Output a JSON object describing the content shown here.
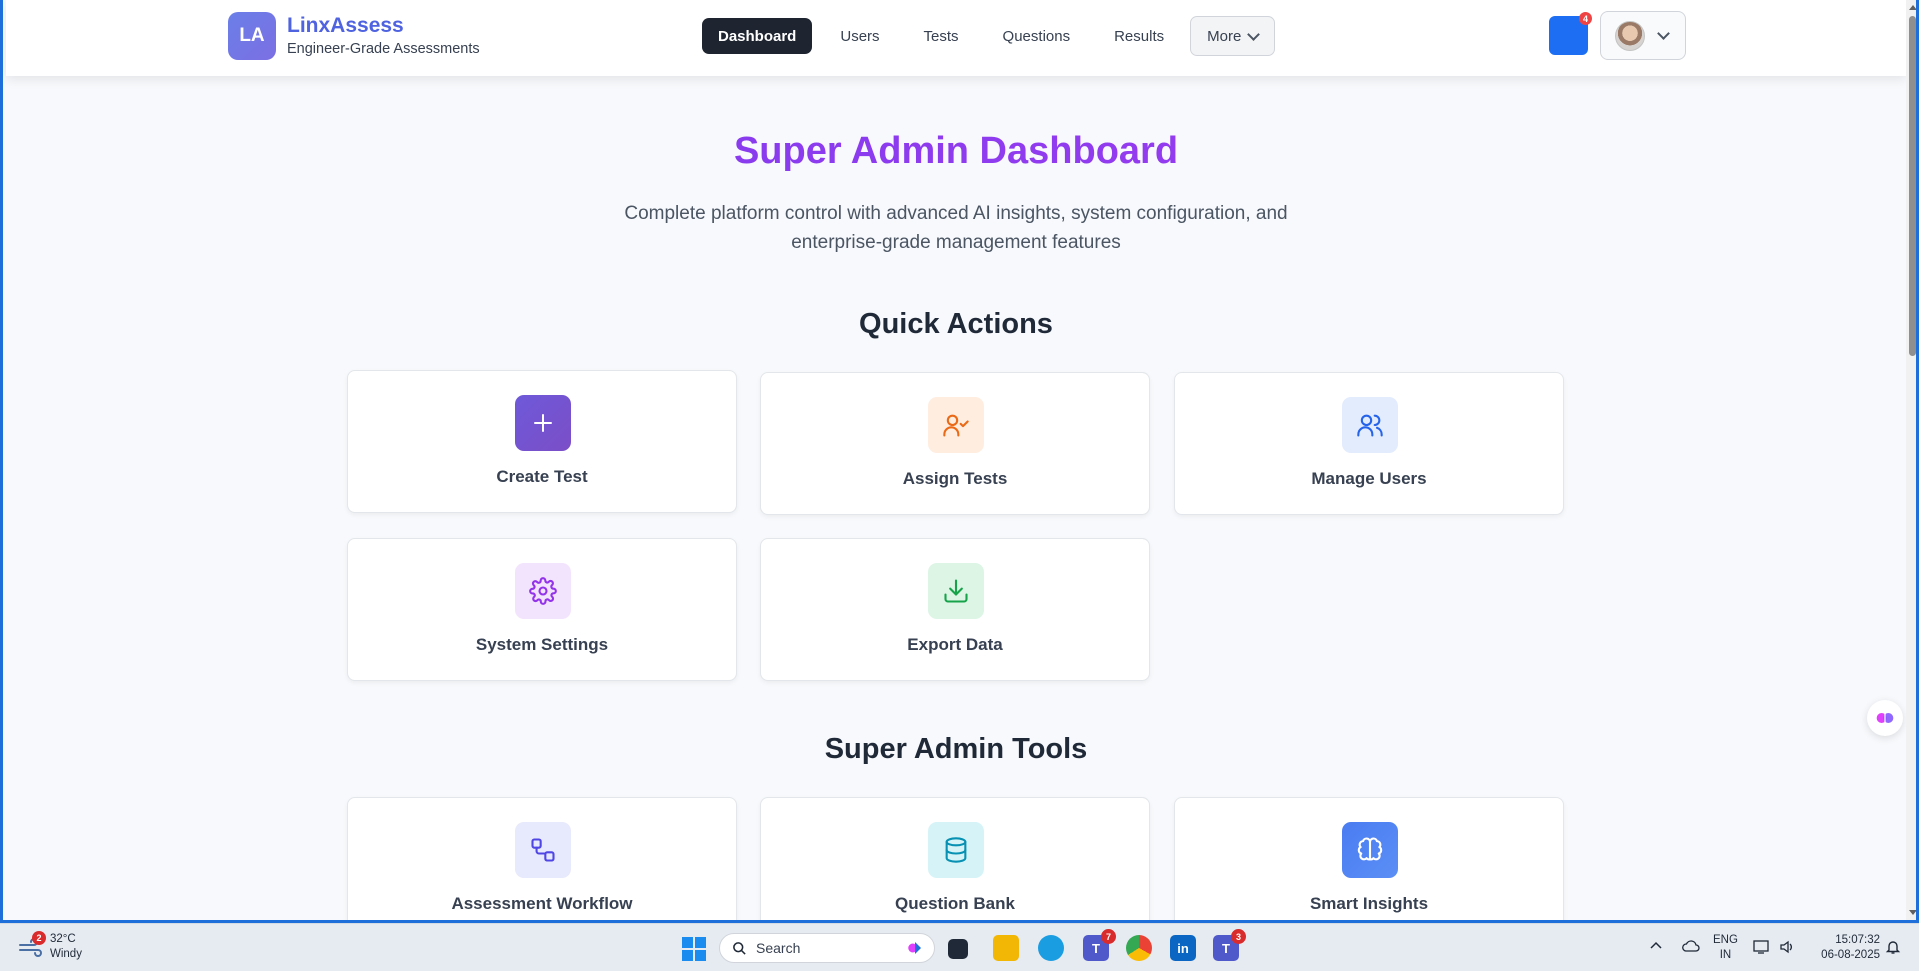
{
  "brand": {
    "logo_initials": "LA",
    "name": "LinxAssess",
    "tagline": "Engineer-Grade Assessments"
  },
  "nav": {
    "items": [
      {
        "label": "Dashboard",
        "active": true
      },
      {
        "label": "Users",
        "active": false
      },
      {
        "label": "Tests",
        "active": false
      },
      {
        "label": "Questions",
        "active": false
      },
      {
        "label": "Results",
        "active": false
      }
    ],
    "more_label": "More"
  },
  "notifications": {
    "count": "4"
  },
  "page": {
    "title": "Super Admin Dashboard",
    "subtitle": "Complete platform control with advanced AI insights, system configuration, and enterprise-grade management features"
  },
  "quick_actions": {
    "title": "Quick Actions",
    "items": [
      {
        "label": "Create Test",
        "icon": "plus-icon"
      },
      {
        "label": "Assign Tests",
        "icon": "user-check-icon"
      },
      {
        "label": "Manage Users",
        "icon": "users-icon"
      },
      {
        "label": "System Settings",
        "icon": "gear-icon"
      },
      {
        "label": "Export Data",
        "icon": "download-icon"
      }
    ]
  },
  "admin_tools": {
    "title": "Super Admin Tools",
    "items": [
      {
        "label": "Assessment Workflow",
        "icon": "workflow-icon"
      },
      {
        "label": "Question Bank",
        "icon": "database-icon"
      },
      {
        "label": "Smart Insights",
        "icon": "brain-icon"
      }
    ]
  },
  "colors": {
    "accent_purple": "#8a3ee0",
    "brand_blue": "#4f63e0",
    "nav_active": "#1e2430"
  },
  "taskbar": {
    "weather": {
      "temp": "32°C",
      "condition": "Windy",
      "badge": "2"
    },
    "search_placeholder": "Search",
    "teams_badge": "7",
    "teams2_badge": "3",
    "lang_top": "ENG",
    "lang_bottom": "IN",
    "time": "15:07:32",
    "date": "06-08-2025"
  }
}
